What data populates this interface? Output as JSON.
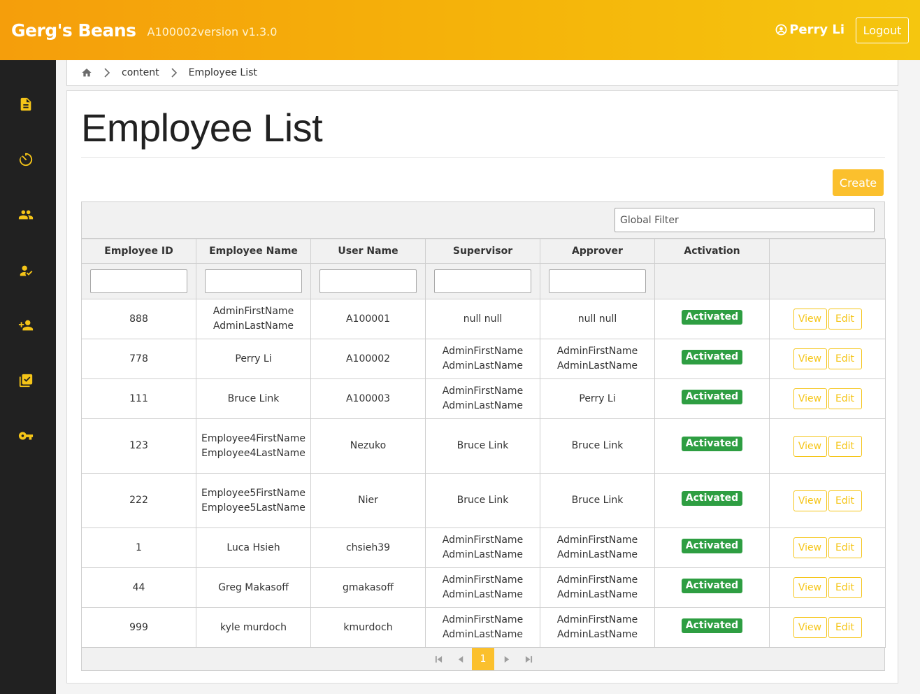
{
  "header": {
    "brand": "Gerg's Beans",
    "version": "A100002version v1.3.0",
    "user_name": "Perry Li",
    "logout_label": "Logout"
  },
  "sidebar": {
    "icons": [
      "document-icon",
      "timer-icon",
      "people-icon",
      "person-check-icon",
      "person-add-icon",
      "checkbox-icon",
      "key-icon"
    ]
  },
  "breadcrumb": {
    "items": [
      "content",
      "Employee List"
    ]
  },
  "page": {
    "title": "Employee List",
    "create_label": "Create",
    "global_filter_placeholder": "Global Filter"
  },
  "table": {
    "columns": [
      "Employee ID",
      "Employee Name",
      "User Name",
      "Supervisor",
      "Approver",
      "Activation",
      ""
    ],
    "view_label": "View",
    "edit_label": "Edit",
    "rows": [
      {
        "id": "888",
        "name": "AdminFirstName AdminLastName",
        "username": "A100001",
        "supervisor": "null null",
        "approver": "null null",
        "activation": "Activated"
      },
      {
        "id": "778",
        "name": "Perry Li",
        "username": "A100002",
        "supervisor": "AdminFirstName AdminLastName",
        "approver": "AdminFirstName AdminLastName",
        "activation": "Activated"
      },
      {
        "id": "111",
        "name": "Bruce Link",
        "username": "A100003",
        "supervisor": "AdminFirstName AdminLastName",
        "approver": "Perry Li",
        "activation": "Activated"
      },
      {
        "id": "123",
        "name": "Employee4FirstName Employee4LastName",
        "username": "Nezuko",
        "supervisor": "Bruce Link",
        "approver": "Bruce Link",
        "activation": "Activated"
      },
      {
        "id": "222",
        "name": "Employee5FirstName Employee5LastName",
        "username": "Nier",
        "supervisor": "Bruce Link",
        "approver": "Bruce Link",
        "activation": "Activated"
      },
      {
        "id": "1",
        "name": "Luca Hsieh",
        "username": "chsieh39",
        "supervisor": "AdminFirstName AdminLastName",
        "approver": "AdminFirstName AdminLastName",
        "activation": "Activated"
      },
      {
        "id": "44",
        "name": "Greg Makasoff",
        "username": "gmakasoff",
        "supervisor": "AdminFirstName AdminLastName",
        "approver": "AdminFirstName AdminLastName",
        "activation": "Activated"
      },
      {
        "id": "999",
        "name": "kyle murdoch",
        "username": "kmurdoch",
        "supervisor": "AdminFirstName AdminLastName",
        "approver": "AdminFirstName AdminLastName",
        "activation": "Activated"
      }
    ]
  },
  "paginator": {
    "current_page": "1"
  },
  "colors": {
    "accent": "#fbc02d",
    "sidebar_bg": "#212121",
    "badge_green": "#2e9e42"
  }
}
